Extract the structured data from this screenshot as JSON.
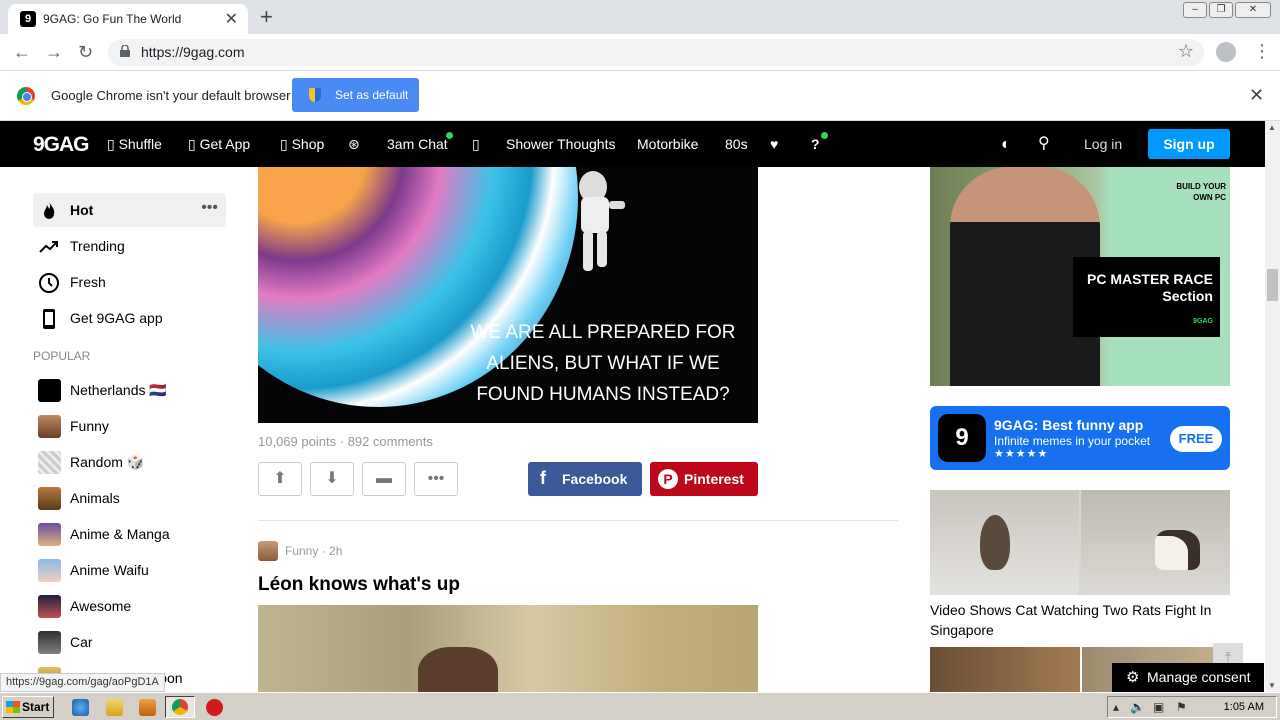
{
  "browser": {
    "tab_title": "9GAG: Go Fun The World",
    "url": "https://9gag.com",
    "infobar_message": "Google Chrome isn't your default browser",
    "set_default_label": "Set as default",
    "status_url": "https://9gag.com/gag/aoPgD1A"
  },
  "nav": {
    "logo": "9GAG",
    "items": [
      "Shuffle",
      "Get App",
      "Shop",
      "3am Chat",
      "Shower Thoughts",
      "Motorbike",
      "80s"
    ],
    "login": "Log in",
    "signup": "Sign up"
  },
  "sidebar": {
    "main": [
      "Hot",
      "Trending",
      "Fresh",
      "Get 9GAG app"
    ],
    "popular_title": "POPULAR",
    "popular": [
      "Netherlands 🇳🇱",
      "Funny",
      "Random 🎲",
      "Animals",
      "Anime & Manga",
      "Anime Waifu",
      "Awesome",
      "Car",
      "Comic & Webtoon"
    ]
  },
  "post1": {
    "caption": "WE ARE ALL PREPARED FOR ALIENS, BUT WHAT IF WE FOUND HUMANS INSTEAD?",
    "stats": "10,069 points · 892 comments",
    "facebook": "Facebook",
    "pinterest": "Pinterest"
  },
  "post2": {
    "meta": "Funny · 2h",
    "title": "Léon knows what's up"
  },
  "right": {
    "ad_build": "BUILD YOUR OWN PC",
    "ad_heading": "PC MASTER RACE Section",
    "ad_brand": "9GAG",
    "app_title": "9GAG: Best funny app",
    "app_subtitle": "Infinite memes in your pocket",
    "app_stars": "★★★★★",
    "app_free": "FREE",
    "video_title": "Video Shows Cat Watching Two Rats Fight In Singapore",
    "consent": "Manage consent"
  },
  "taskbar": {
    "start": "Start",
    "time": "1:05 AM"
  }
}
